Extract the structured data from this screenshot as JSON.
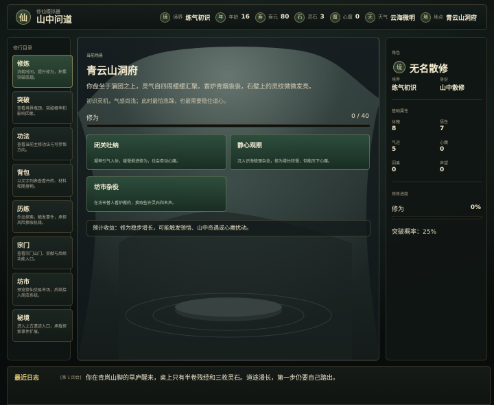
{
  "header": {
    "logo_char": "仙",
    "subtitle": "修仙模拟器",
    "title": "山中问道",
    "stats": [
      {
        "badge": "境",
        "label": "境界",
        "value": "练气初识"
      },
      {
        "badge": "年",
        "label": "年龄",
        "value": "16"
      },
      {
        "badge": "寿",
        "label": "寿元",
        "value": "80"
      },
      {
        "badge": "石",
        "label": "灵石",
        "value": "3"
      },
      {
        "badge": "魔",
        "label": "心魔",
        "value": "0"
      },
      {
        "badge": "天",
        "label": "天气",
        "value": "云海微明"
      },
      {
        "badge": "地",
        "label": "地点",
        "value": "青云山洞府"
      }
    ]
  },
  "sidebar": {
    "title": "修行目录",
    "items": [
      {
        "name": "修炼",
        "desc": "消耗时间，提升修为，积累突破底蕴。"
      },
      {
        "name": "突破",
        "desc": "查看境界瓶颈，突破概率和影响因素。"
      },
      {
        "name": "功法",
        "desc": "查看当前主修功法与可参悟方向。"
      },
      {
        "name": "背包",
        "desc": "以文字列表查看丹药、材料和随身物。"
      },
      {
        "name": "历练",
        "desc": "外出探索，触发事件，承担风险换取机缘。"
      },
      {
        "name": "宗门",
        "desc": "查看宗门山门，贡献与后续功能入口。"
      },
      {
        "name": "坊市",
        "desc": "预览修仙交易市场，后续接入商店系统。"
      },
      {
        "name": "秘境",
        "desc": "进入上古遗迹入口，承载探索事件扩展。"
      }
    ]
  },
  "scene": {
    "label": "当前场景",
    "title": "青云山洞府",
    "desc1": "你盘坐于蒲团之上，灵气自四周缓缓汇聚。香炉青烟袅袅，石壁上的灵纹微微发亮。",
    "desc2": "初识灵机，气感尚浅；此时最怕急躁，也最需要稳住道心。",
    "progress_label": "修为",
    "progress_text": "0 / 40",
    "progress_fraction": 0.0,
    "actions": [
      {
        "title": "闭关吐纳",
        "desc": "凝神引气入体，缓慢推进修为，也会牵动心魔。"
      },
      {
        "title": "静心观照",
        "desc": "沉入识海梳理杂念，修为增长较慢，但能压下心魔。"
      },
      {
        "title": "坊市杂役",
        "desc": "在坊市替人看炉搬药，换取些许灵石和名声。"
      }
    ],
    "forecast": "预计收益：修为稳步增长，可能触发顿悟、山中奇遇或心魔扰动。"
  },
  "character": {
    "section": "角色",
    "badge": "境",
    "name": "无名散修",
    "realm_label": "境界",
    "realm_value": "练气初识",
    "identity_label": "身份",
    "identity_value": "山中散修",
    "attr_title": "基础属性",
    "attrs": [
      {
        "label": "体魄",
        "value": "8"
      },
      {
        "label": "悟性",
        "value": "7"
      },
      {
        "label": "气运",
        "value": "5"
      },
      {
        "label": "心魔",
        "value": "0"
      },
      {
        "label": "因果",
        "value": "0"
      },
      {
        "label": "声望",
        "value": "0"
      }
    ],
    "progress_title": "修炼进度",
    "cult_label": "修为",
    "cult_percent": "0%",
    "cult_fraction": 0.0,
    "breakthrough": "突破概率：25%"
  },
  "log": {
    "title": "最近日志",
    "round": "[第 1 回合]",
    "text": "你在青岚山脚的草庐醒来，桌上只有半卷残经和三枚灵石。道途漫长，第一步仍要自己踏出。"
  },
  "colors": {
    "accent_gold": "#e2c77a",
    "accent_green": "#9ad08b",
    "panel_bg": "#101614"
  }
}
